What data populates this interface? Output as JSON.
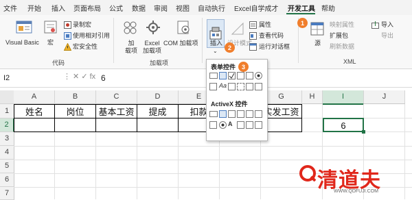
{
  "ribbon_tabs": [
    "文件",
    "开始",
    "插入",
    "页面布局",
    "公式",
    "数据",
    "审阅",
    "视图",
    "自动执行",
    "Excel自学成才",
    "开发工具",
    "帮助"
  ],
  "code_group": {
    "visual_basic": "Visual Basic",
    "macros": "宏",
    "record_macro": "录制宏",
    "relative_ref": "使用相对引用",
    "macro_security": "宏安全性",
    "label": "代码"
  },
  "addins_group": {
    "addins": "加\n载项",
    "excel_addins": "Excel\n加载项",
    "com_addins": "COM 加载项",
    "label": "加载项"
  },
  "controls_group": {
    "insert": "插入",
    "design_mode": "设计模式",
    "properties": "属性",
    "view_code": "查看代码",
    "run_dialog": "运行对话框"
  },
  "xml_group": {
    "source": "源",
    "map_properties": "映射属性",
    "expansion_packs": "扩展包",
    "refresh_data": "刷新数据",
    "import": "导入",
    "export": "导出",
    "label": "XML"
  },
  "dropdown": {
    "form_controls": "表单控件",
    "activex_controls": "ActiveX 控件"
  },
  "badges": [
    "1",
    "2",
    "3"
  ],
  "formula_bar": {
    "name_box": "I2",
    "fx_icons": "⋮  ✕  ✓  fx",
    "value": "6"
  },
  "columns": [
    "A",
    "B",
    "C",
    "D",
    "E",
    "F",
    "G",
    "H",
    "I",
    "J"
  ],
  "rows": [
    "1",
    "2",
    "3",
    "4",
    "5",
    "6",
    "7"
  ],
  "headers": [
    "姓名",
    "岗位",
    "基本工资",
    "提成",
    "扣款",
    "",
    "实发工资"
  ],
  "cell_I2": "6",
  "watermark": {
    "brand": "清道夫",
    "url": "WWW.QDFUJI.COM"
  },
  "colors": {
    "accent": "#217346",
    "badge": "#f07e2c",
    "watermark": "#e0271b"
  }
}
